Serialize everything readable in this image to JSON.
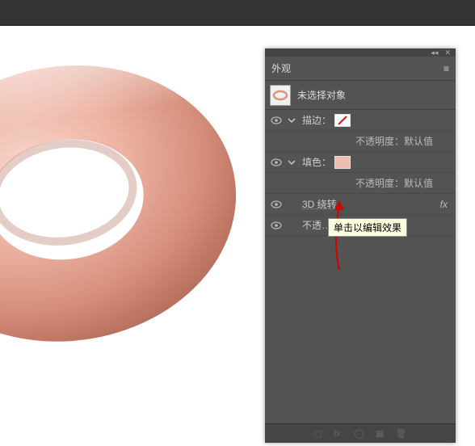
{
  "panel": {
    "title": "外观",
    "no_selection": "未选择对象",
    "rows": {
      "stroke": {
        "label": "描边："
      },
      "stroke_opacity": "不透明度：默认值",
      "fill": {
        "label": "填色："
      },
      "fill_opacity": "不透明度：默认值",
      "revolve": "3D  绕转",
      "opacity": "不透…明度，默认值"
    },
    "fx": "fx"
  },
  "tooltip": "单击以编辑效果",
  "footer": {
    "newfx": "fx.",
    "clear": "◯",
    "dup": "▦",
    "trash": "🗑"
  },
  "controls": {
    "collapse": "◂◂",
    "close": "✕",
    "menu": "≡"
  }
}
